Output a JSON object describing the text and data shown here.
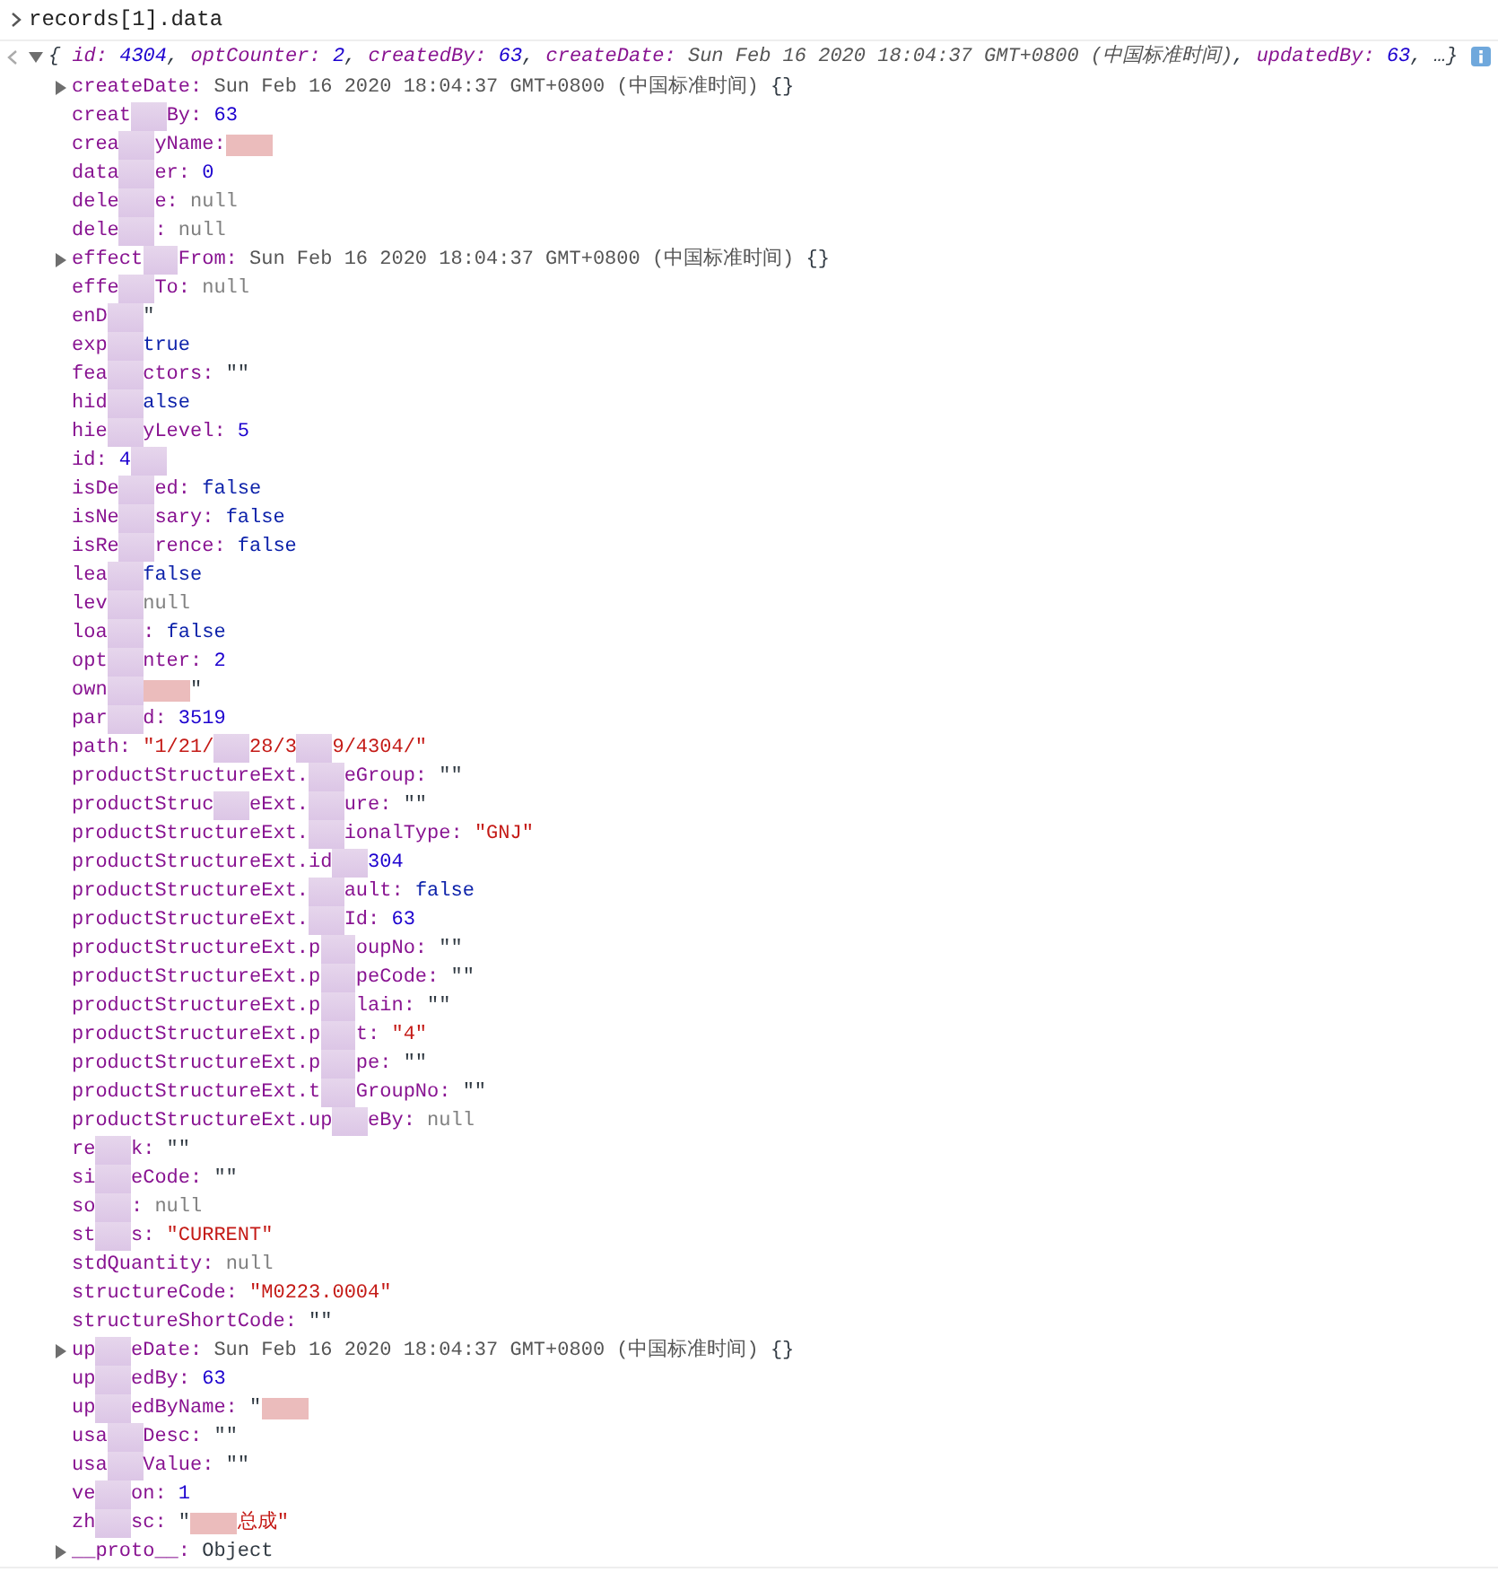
{
  "input": {
    "expression": "records[1].data"
  },
  "result": {
    "expanded": true,
    "summary": [
      {
        "kind": "punct",
        "text": "{"
      },
      {
        "kind": "key",
        "text": "id:"
      },
      {
        "kind": "number",
        "text": "4304"
      },
      {
        "kind": "punct",
        "text": ","
      },
      {
        "kind": "key",
        "text": "optCounter:"
      },
      {
        "kind": "number",
        "text": "2"
      },
      {
        "kind": "punct",
        "text": ","
      },
      {
        "kind": "key",
        "text": "createdBy:"
      },
      {
        "kind": "number",
        "text": "63"
      },
      {
        "kind": "punct",
        "text": ","
      },
      {
        "kind": "key",
        "text": "createDate:"
      },
      {
        "kind": "date",
        "text": "Sun Feb 16 2020 18:04:37 GMT+0800 (中国标准时间)"
      },
      {
        "kind": "punct",
        "text": ","
      },
      {
        "kind": "key",
        "text": "updatedBy:"
      },
      {
        "kind": "number",
        "text": "63"
      },
      {
        "kind": "punct",
        "text": ", …}"
      }
    ],
    "rows": [
      {
        "kind": "object",
        "expanded": false,
        "segments": [
          {
            "kind": "key",
            "text": "createDate:"
          },
          {
            "kind": "date",
            "text": "Sun Feb 16 2020 18:04:37 GMT+0800 (中国标准时间)"
          },
          {
            "kind": "punct",
            "text": "{}"
          }
        ]
      },
      {
        "kind": "property",
        "segments": [
          {
            "kind": "key",
            "text": "creat"
          },
          {
            "kind": "smudge"
          },
          {
            "kind": "key",
            "text": "By:"
          },
          {
            "kind": "number",
            "text": "63"
          }
        ]
      },
      {
        "kind": "property",
        "segments": [
          {
            "kind": "key",
            "text": "crea"
          },
          {
            "kind": "smudge"
          },
          {
            "kind": "key",
            "text": "yName:"
          },
          {
            "kind": "redaction"
          }
        ]
      },
      {
        "kind": "property",
        "segments": [
          {
            "kind": "key",
            "text": "data"
          },
          {
            "kind": "smudge"
          },
          {
            "kind": "key",
            "text": "er:"
          },
          {
            "kind": "number",
            "text": "0"
          }
        ]
      },
      {
        "kind": "property",
        "segments": [
          {
            "kind": "key",
            "text": "dele"
          },
          {
            "kind": "smudge"
          },
          {
            "kind": "key",
            "text": "e:"
          },
          {
            "kind": "null",
            "text": "null"
          }
        ]
      },
      {
        "kind": "property",
        "segments": [
          {
            "kind": "key",
            "text": "dele"
          },
          {
            "kind": "smudge"
          },
          {
            "kind": "key",
            "text": ":"
          },
          {
            "kind": "null",
            "text": "null"
          }
        ]
      },
      {
        "kind": "object",
        "expanded": false,
        "segments": [
          {
            "kind": "key",
            "text": "effect"
          },
          {
            "kind": "smudge"
          },
          {
            "kind": "key",
            "text": "From:"
          },
          {
            "kind": "date",
            "text": "Sun Feb 16 2020 18:04:37 GMT+0800 (中国标准时间)"
          },
          {
            "kind": "punct",
            "text": "{}"
          }
        ]
      },
      {
        "kind": "property",
        "segments": [
          {
            "kind": "key",
            "text": "effe"
          },
          {
            "kind": "smudge"
          },
          {
            "kind": "key",
            "text": "To:"
          },
          {
            "kind": "null",
            "text": "null"
          }
        ]
      },
      {
        "kind": "property",
        "segments": [
          {
            "kind": "key",
            "text": "enD"
          },
          {
            "kind": "smudge"
          },
          {
            "kind": "punct",
            "text": "\""
          }
        ]
      },
      {
        "kind": "property",
        "segments": [
          {
            "kind": "key",
            "text": "exp"
          },
          {
            "kind": "smudge"
          },
          {
            "kind": "bool",
            "text": "true"
          }
        ]
      },
      {
        "kind": "property",
        "segments": [
          {
            "kind": "key",
            "text": "fea"
          },
          {
            "kind": "smudge"
          },
          {
            "kind": "key",
            "text": "ctors:"
          },
          {
            "kind": "punct",
            "text": "\"\""
          }
        ]
      },
      {
        "kind": "property",
        "segments": [
          {
            "kind": "key",
            "text": "hid"
          },
          {
            "kind": "smudge"
          },
          {
            "kind": "bool",
            "text": "alse"
          }
        ]
      },
      {
        "kind": "property",
        "segments": [
          {
            "kind": "key",
            "text": "hie"
          },
          {
            "kind": "smudge"
          },
          {
            "kind": "key",
            "text": "yLevel:"
          },
          {
            "kind": "number",
            "text": "5"
          }
        ]
      },
      {
        "kind": "property",
        "segments": [
          {
            "kind": "key",
            "text": "id:"
          },
          {
            "kind": "number",
            "text": "4"
          },
          {
            "kind": "smudge"
          }
        ]
      },
      {
        "kind": "property",
        "segments": [
          {
            "kind": "key",
            "text": "isDe"
          },
          {
            "kind": "smudge"
          },
          {
            "kind": "key",
            "text": "ed:"
          },
          {
            "kind": "bool",
            "text": "false"
          }
        ]
      },
      {
        "kind": "property",
        "segments": [
          {
            "kind": "key",
            "text": "isNe"
          },
          {
            "kind": "smudge"
          },
          {
            "kind": "key",
            "text": "sary:"
          },
          {
            "kind": "bool",
            "text": "false"
          }
        ]
      },
      {
        "kind": "property",
        "segments": [
          {
            "kind": "key",
            "text": "isRe"
          },
          {
            "kind": "smudge"
          },
          {
            "kind": "key",
            "text": "rence:"
          },
          {
            "kind": "bool",
            "text": "false"
          }
        ]
      },
      {
        "kind": "property",
        "segments": [
          {
            "kind": "key",
            "text": "lea"
          },
          {
            "kind": "smudge"
          },
          {
            "kind": "bool",
            "text": "false"
          }
        ]
      },
      {
        "kind": "property",
        "segments": [
          {
            "kind": "key",
            "text": "lev"
          },
          {
            "kind": "smudge"
          },
          {
            "kind": "null",
            "text": "null"
          }
        ]
      },
      {
        "kind": "property",
        "segments": [
          {
            "kind": "key",
            "text": "loa"
          },
          {
            "kind": "smudge"
          },
          {
            "kind": "key",
            "text": ":"
          },
          {
            "kind": "bool",
            "text": "false"
          }
        ]
      },
      {
        "kind": "property",
        "segments": [
          {
            "kind": "key",
            "text": "opt"
          },
          {
            "kind": "smudge"
          },
          {
            "kind": "key",
            "text": "nter:"
          },
          {
            "kind": "number",
            "text": "2"
          }
        ]
      },
      {
        "kind": "property",
        "segments": [
          {
            "kind": "key",
            "text": "own"
          },
          {
            "kind": "smudge"
          },
          {
            "kind": "redaction"
          },
          {
            "kind": "punct",
            "text": "\""
          }
        ]
      },
      {
        "kind": "property",
        "segments": [
          {
            "kind": "key",
            "text": "par"
          },
          {
            "kind": "smudge"
          },
          {
            "kind": "key",
            "text": "d:"
          },
          {
            "kind": "number",
            "text": "3519"
          }
        ]
      },
      {
        "kind": "property",
        "segments": [
          {
            "kind": "key",
            "text": "path:"
          },
          {
            "kind": "string",
            "text": "\"1/21/"
          },
          {
            "kind": "smudge"
          },
          {
            "kind": "string",
            "text": "28/3"
          },
          {
            "kind": "smudge"
          },
          {
            "kind": "string",
            "text": "9/4304/\""
          }
        ]
      },
      {
        "kind": "property",
        "segments": [
          {
            "kind": "key",
            "text": "productStructureExt."
          },
          {
            "kind": "smudge"
          },
          {
            "kind": "key",
            "text": "eGroup:"
          },
          {
            "kind": "punct",
            "text": "\"\""
          }
        ]
      },
      {
        "kind": "property",
        "segments": [
          {
            "kind": "key",
            "text": "productStruc"
          },
          {
            "kind": "smudge"
          },
          {
            "kind": "key",
            "text": "eExt."
          },
          {
            "kind": "smudge"
          },
          {
            "kind": "key",
            "text": "ure:"
          },
          {
            "kind": "punct",
            "text": "\"\""
          }
        ]
      },
      {
        "kind": "property",
        "segments": [
          {
            "kind": "key",
            "text": "productStructureExt."
          },
          {
            "kind": "smudge"
          },
          {
            "kind": "key",
            "text": "ionalType:"
          },
          {
            "kind": "string",
            "text": "\"GNJ\""
          }
        ]
      },
      {
        "kind": "property",
        "segments": [
          {
            "kind": "key",
            "text": "productStructureExt.id"
          },
          {
            "kind": "smudge"
          },
          {
            "kind": "number",
            "text": "304"
          }
        ]
      },
      {
        "kind": "property",
        "segments": [
          {
            "kind": "key",
            "text": "productStructureExt."
          },
          {
            "kind": "smudge"
          },
          {
            "kind": "key",
            "text": "ault:"
          },
          {
            "kind": "bool",
            "text": "false"
          }
        ]
      },
      {
        "kind": "property",
        "segments": [
          {
            "kind": "key",
            "text": "productStructureExt."
          },
          {
            "kind": "smudge"
          },
          {
            "kind": "key",
            "text": "Id:"
          },
          {
            "kind": "number",
            "text": "63"
          }
        ]
      },
      {
        "kind": "property",
        "segments": [
          {
            "kind": "key",
            "text": "productStructureExt.p"
          },
          {
            "kind": "smudge"
          },
          {
            "kind": "key",
            "text": "oupNo:"
          },
          {
            "kind": "punct",
            "text": "\"\""
          }
        ]
      },
      {
        "kind": "property",
        "segments": [
          {
            "kind": "key",
            "text": "productStructureExt.p"
          },
          {
            "kind": "smudge"
          },
          {
            "kind": "key",
            "text": "peCode:"
          },
          {
            "kind": "punct",
            "text": "\"\""
          }
        ]
      },
      {
        "kind": "property",
        "segments": [
          {
            "kind": "key",
            "text": "productStructureExt.p"
          },
          {
            "kind": "smudge"
          },
          {
            "kind": "key",
            "text": "lain:"
          },
          {
            "kind": "punct",
            "text": "\"\""
          }
        ]
      },
      {
        "kind": "property",
        "segments": [
          {
            "kind": "key",
            "text": "productStructureExt.p"
          },
          {
            "kind": "smudge"
          },
          {
            "kind": "key",
            "text": "t:"
          },
          {
            "kind": "string",
            "text": "\"4\""
          }
        ]
      },
      {
        "kind": "property",
        "segments": [
          {
            "kind": "key",
            "text": "productStructureExt.p"
          },
          {
            "kind": "smudge"
          },
          {
            "kind": "key",
            "text": "pe:"
          },
          {
            "kind": "punct",
            "text": "\"\""
          }
        ]
      },
      {
        "kind": "property",
        "segments": [
          {
            "kind": "key",
            "text": "productStructureExt.t"
          },
          {
            "kind": "smudge"
          },
          {
            "kind": "key",
            "text": "GroupNo:"
          },
          {
            "kind": "punct",
            "text": "\"\""
          }
        ]
      },
      {
        "kind": "property",
        "segments": [
          {
            "kind": "key",
            "text": "productStructureExt.up"
          },
          {
            "kind": "smudge"
          },
          {
            "kind": "key",
            "text": "eBy:"
          },
          {
            "kind": "null",
            "text": "null"
          }
        ]
      },
      {
        "kind": "property",
        "segments": [
          {
            "kind": "key",
            "text": "re"
          },
          {
            "kind": "smudge"
          },
          {
            "kind": "key",
            "text": "k:"
          },
          {
            "kind": "punct",
            "text": "\"\""
          }
        ]
      },
      {
        "kind": "property",
        "segments": [
          {
            "kind": "key",
            "text": "si"
          },
          {
            "kind": "smudge"
          },
          {
            "kind": "key",
            "text": "eCode:"
          },
          {
            "kind": "punct",
            "text": "\"\""
          }
        ]
      },
      {
        "kind": "property",
        "segments": [
          {
            "kind": "key",
            "text": "so"
          },
          {
            "kind": "smudge"
          },
          {
            "kind": "key",
            "text": ":"
          },
          {
            "kind": "null",
            "text": "null"
          }
        ]
      },
      {
        "kind": "property",
        "segments": [
          {
            "kind": "key",
            "text": "st"
          },
          {
            "kind": "smudge"
          },
          {
            "kind": "key",
            "text": "s:"
          },
          {
            "kind": "string",
            "text": "\"CURRENT\""
          }
        ]
      },
      {
        "kind": "property",
        "segments": [
          {
            "kind": "key",
            "text": "stdQuantity:"
          },
          {
            "kind": "null",
            "text": "null"
          }
        ]
      },
      {
        "kind": "property",
        "segments": [
          {
            "kind": "key",
            "text": "structureCode:"
          },
          {
            "kind": "string",
            "text": "\"M0223.0004\""
          }
        ]
      },
      {
        "kind": "property",
        "segments": [
          {
            "kind": "key",
            "text": "structureShortCode:"
          },
          {
            "kind": "punct",
            "text": "\"\""
          }
        ]
      },
      {
        "kind": "object",
        "expanded": false,
        "segments": [
          {
            "kind": "key",
            "text": "up"
          },
          {
            "kind": "smudge"
          },
          {
            "kind": "key",
            "text": "eDate:"
          },
          {
            "kind": "date",
            "text": "Sun Feb 16 2020 18:04:37 GMT+0800 (中国标准时间)"
          },
          {
            "kind": "punct",
            "text": "{}"
          }
        ]
      },
      {
        "kind": "property",
        "segments": [
          {
            "kind": "key",
            "text": "up"
          },
          {
            "kind": "smudge"
          },
          {
            "kind": "key",
            "text": "edBy:"
          },
          {
            "kind": "number",
            "text": "63"
          }
        ]
      },
      {
        "kind": "property",
        "segments": [
          {
            "kind": "key",
            "text": "up"
          },
          {
            "kind": "smudge"
          },
          {
            "kind": "key",
            "text": "edByName:"
          },
          {
            "kind": "punct",
            "text": "\""
          },
          {
            "kind": "redaction"
          }
        ]
      },
      {
        "kind": "property",
        "segments": [
          {
            "kind": "key",
            "text": "usa"
          },
          {
            "kind": "smudge"
          },
          {
            "kind": "key",
            "text": "Desc:"
          },
          {
            "kind": "punct",
            "text": "\"\""
          }
        ]
      },
      {
        "kind": "property",
        "segments": [
          {
            "kind": "key",
            "text": "usa"
          },
          {
            "kind": "smudge"
          },
          {
            "kind": "key",
            "text": "Value:"
          },
          {
            "kind": "punct",
            "text": "\"\""
          }
        ]
      },
      {
        "kind": "property",
        "segments": [
          {
            "kind": "key",
            "text": "ve"
          },
          {
            "kind": "smudge"
          },
          {
            "kind": "key",
            "text": "on:"
          },
          {
            "kind": "number",
            "text": "1"
          }
        ]
      },
      {
        "kind": "property",
        "segments": [
          {
            "kind": "key",
            "text": "zh"
          },
          {
            "kind": "smudge"
          },
          {
            "kind": "key",
            "text": "sc:"
          },
          {
            "kind": "punct",
            "text": "\""
          },
          {
            "kind": "redaction"
          },
          {
            "kind": "string",
            "text": "总成\""
          }
        ]
      },
      {
        "kind": "object",
        "expanded": false,
        "segments": [
          {
            "kind": "proto",
            "text": "__proto__:"
          },
          {
            "kind": "punct",
            "text": "Object"
          }
        ]
      }
    ]
  }
}
